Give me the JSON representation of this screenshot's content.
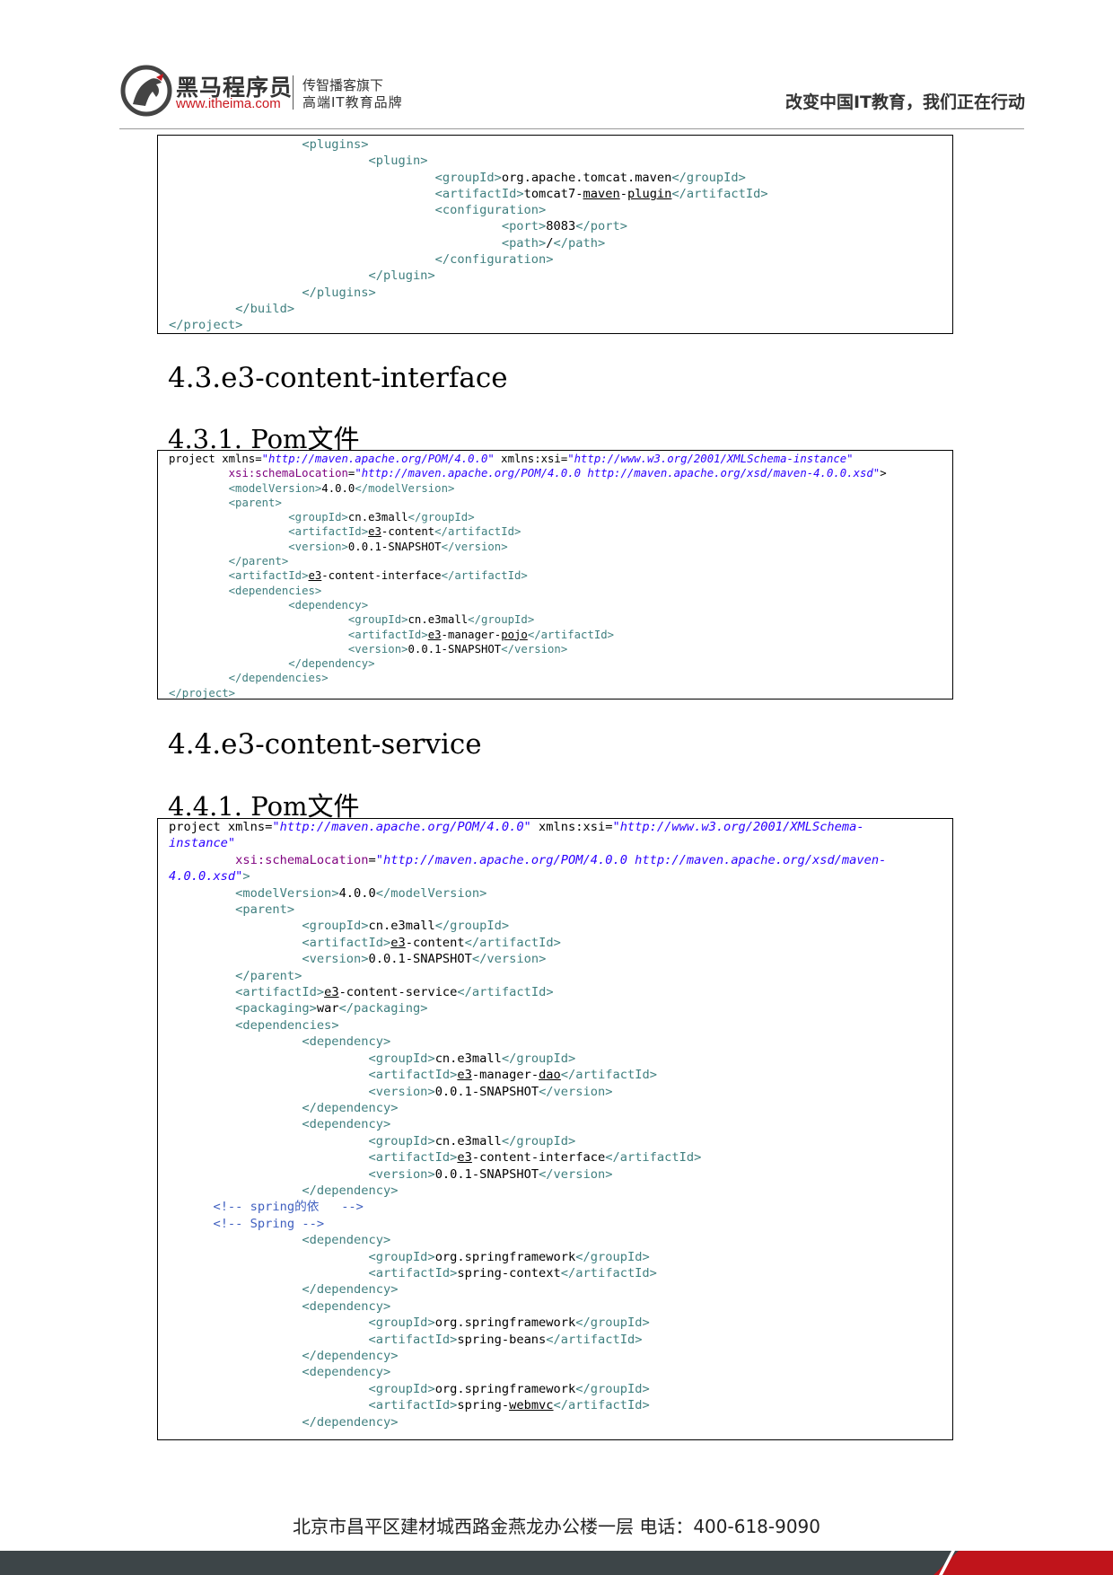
{
  "header": {
    "brand_name": "黑马程序员",
    "brand_url": "www.itheima.com",
    "tag_line1": "传智播客旗下",
    "tag_line2": "高端IT教育品牌",
    "slogan": "改变中国IT教育，我们正在行动",
    "brand_color": "#c9171e"
  },
  "headings": {
    "h43": "4.3.e3-content-interface",
    "h431": "4.3.1. Pom文件",
    "h44": "4.4.e3-content-service",
    "h441": "4.4.1. Pom文件"
  },
  "code_block_1": {
    "lines": [
      "      <plugins>",
      "         <plugin>",
      "            <groupId>org.apache.tomcat.maven</groupId>",
      "            <artifactId>tomcat7-maven-plugin</artifactId>",
      "            <configuration>",
      "               <port>8083</port>",
      "               <path>/</path>",
      "            </configuration>",
      "         </plugin>",
      "      </plugins>",
      "   </build>",
      "</project>"
    ]
  },
  "code_block_2": {
    "lines": [
      "<project xmlns=\"http://maven.apache.org/POM/4.0.0\" xmlns:xsi=\"http://www.w3.org/2001/XMLSchema-instance\"",
      "   xsi:schemaLocation=\"http://maven.apache.org/POM/4.0.0 http://maven.apache.org/xsd/maven-4.0.0.xsd\">",
      "   <modelVersion>4.0.0</modelVersion>",
      "   <parent>",
      "      <groupId>cn.e3mall</groupId>",
      "      <artifactId>e3-content</artifactId>",
      "      <version>0.0.1-SNAPSHOT</version>",
      "   </parent>",
      "   <artifactId>e3-content-interface</artifactId>",
      "   <dependencies>",
      "      <dependency>",
      "         <groupId>cn.e3mall</groupId>",
      "         <artifactId>e3-manager-pojo</artifactId>",
      "         <version>0.0.1-SNAPSHOT</version>",
      "      </dependency>",
      "   </dependencies>",
      "</project>"
    ]
  },
  "code_block_3": {
    "lines": [
      "<project xmlns=\"http://maven.apache.org/POM/4.0.0\" xmlns:xsi=\"http://www.w3.org/2001/XMLSchema-",
      "instance\"",
      "   xsi:schemaLocation=\"http://maven.apache.org/POM/4.0.0 http://maven.apache.org/xsd/maven-",
      "4.0.0.xsd\">",
      "   <modelVersion>4.0.0</modelVersion>",
      "   <parent>",
      "      <groupId>cn.e3mall</groupId>",
      "      <artifactId>e3-content</artifactId>",
      "      <version>0.0.1-SNAPSHOT</version>",
      "   </parent>",
      "   <artifactId>e3-content-service</artifactId>",
      "   <packaging>war</packaging>",
      "   <dependencies>",
      "      <dependency>",
      "         <groupId>cn.e3mall</groupId>",
      "         <artifactId>e3-manager-dao</artifactId>",
      "         <version>0.0.1-SNAPSHOT</version>",
      "      </dependency>",
      "      <dependency>",
      "         <groupId>cn.e3mall</groupId>",
      "         <artifactId>e3-content-interface</artifactId>",
      "         <version>0.0.1-SNAPSHOT</version>",
      "      </dependency>",
      "      <!-- spring的依   -->",
      "      <!-- Spring -->",
      "      <dependency>",
      "         <groupId>org.springframework</groupId>",
      "         <artifactId>spring-context</artifactId>",
      "      </dependency>",
      "      <dependency>",
      "         <groupId>org.springframework</groupId>",
      "         <artifactId>spring-beans</artifactId>",
      "      </dependency>",
      "      <dependency>",
      "         <groupId>org.springframework</groupId>",
      "         <artifactId>spring-webmvc</artifactId>",
      "      </dependency>"
    ]
  },
  "footer": {
    "address": "北京市昌平区建材城西路金燕龙办公楼一层   电话：400-618-9090",
    "bar_color": "#3d4548",
    "accent_color": "#c0141b"
  }
}
